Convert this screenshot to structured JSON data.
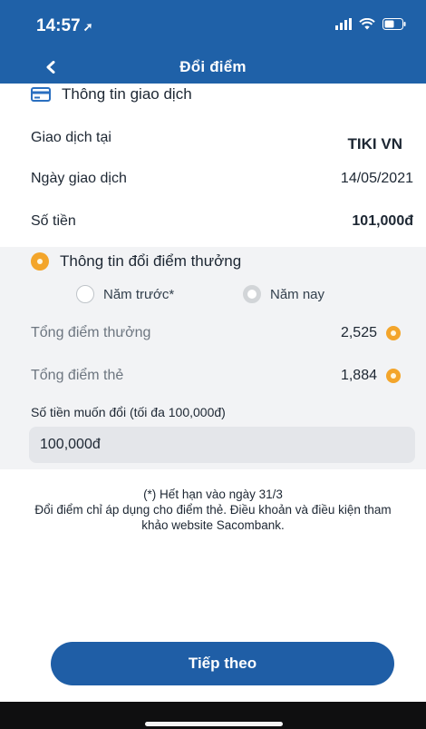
{
  "status_bar": {
    "time": "14:57",
    "location_arrow": "➚"
  },
  "nav": {
    "title": "Đổi điểm",
    "back_icon": "chevron-left-icon"
  },
  "transaction": {
    "heading": "Thông tin giao dịch",
    "heading_icon": "card-icon",
    "rows": [
      {
        "label": "Giao dịch tại",
        "value": "TIKI VN"
      },
      {
        "label": "Ngày giao dịch",
        "value": "14/05/2021"
      },
      {
        "label": "Số tiền",
        "value": "101,000đ"
      }
    ]
  },
  "reward": {
    "heading": "Thông tin đổi điểm thưởng",
    "heading_icon": "coin-icon",
    "options": [
      {
        "label": "Năm trước*",
        "selected": false
      },
      {
        "label": "Năm nay",
        "selected": true
      }
    ],
    "total_reward_label": "Tổng điểm thưởng",
    "total_reward_value": "2,525",
    "total_card_label": "Tổng điểm thẻ",
    "total_card_value": "1,884",
    "amount_label": "Số tiền muốn đổi (tối đa 100,000đ)",
    "amount_value": "100,000đ"
  },
  "note": {
    "line1": "(*) Hết hạn vào ngày 31/3",
    "line2": "Đổi điểm chỉ áp dụng cho điểm thẻ. Điều khoản và điều kiện tham khảo website Sacombank."
  },
  "actions": {
    "next_label": "Tiếp theo"
  },
  "colors": {
    "primary": "#1f61a8",
    "coin": "#f3a52b",
    "panel": "#f2f3f5"
  }
}
